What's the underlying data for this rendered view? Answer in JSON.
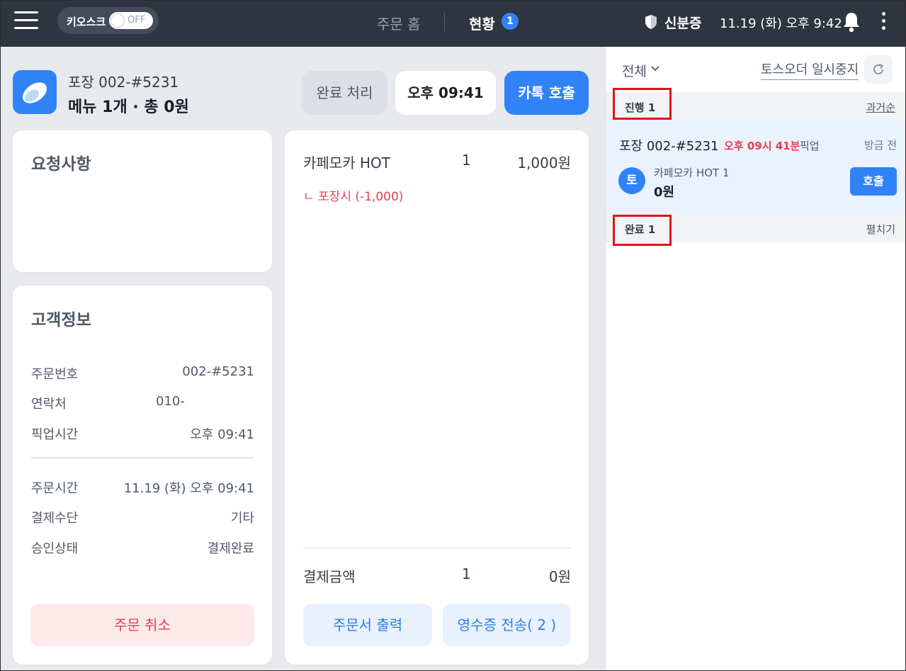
{
  "topbar": {
    "kiosk_label": "키오스크",
    "kiosk_state": "OFF",
    "nav_home": "주문 홈",
    "nav_status": "현황",
    "nav_status_count": "1",
    "id_label": "신분증",
    "datetime": "11.19 (화) 오후 9:42"
  },
  "order": {
    "title": "포장 002-#5231",
    "summary": "메뉴 1개 · 총 0원",
    "complete_button": "완료 처리",
    "time_button": "오후 09:41",
    "kakao_button": "카톡 호출"
  },
  "request": {
    "heading": "요청사항"
  },
  "customer": {
    "heading": "고객정보",
    "rows": [
      {
        "label": "주문번호",
        "value": "002-#5231"
      },
      {
        "label": "연락처",
        "value": "010-"
      },
      {
        "label": "픽업시간",
        "value": "오후 09:41"
      },
      {
        "label": "주문시간",
        "value": "11.19 (화) 오후 09:41"
      },
      {
        "label": "결제수단",
        "value": "기타"
      },
      {
        "label": "승인상태",
        "value": "결제완료"
      }
    ],
    "cancel_button": "주문 취소"
  },
  "items": {
    "list": [
      {
        "name": "카페모카 HOT",
        "qty": "1",
        "price": "1,000원",
        "option": "ㄴ 포장시 (-1,000)"
      }
    ],
    "total_label": "결제금액",
    "total_qty": "1",
    "total_price": "0원",
    "print_button": "주문서 출력",
    "receipt_button": "영수증 전송( 2 )"
  },
  "side": {
    "filter": "전체",
    "pause_link": "토스오더 일시중지",
    "progress_label": "진행 1",
    "progress_sort": "과거순",
    "done_label": "완료 1",
    "done_expand": "펼치기",
    "orders": [
      {
        "title": "포장 002-#5231",
        "time": "오후 09시 41분",
        "pickup": "픽업",
        "ago": "방금 전",
        "avatar": "토",
        "menu": "카페모카 HOT 1",
        "amount": "0원",
        "call_button": "호출"
      }
    ]
  },
  "colors": {
    "topbar": "#2f3441",
    "accent": "#3182f6",
    "danger": "#e8404e",
    "highlight_box": "#e0141a"
  }
}
